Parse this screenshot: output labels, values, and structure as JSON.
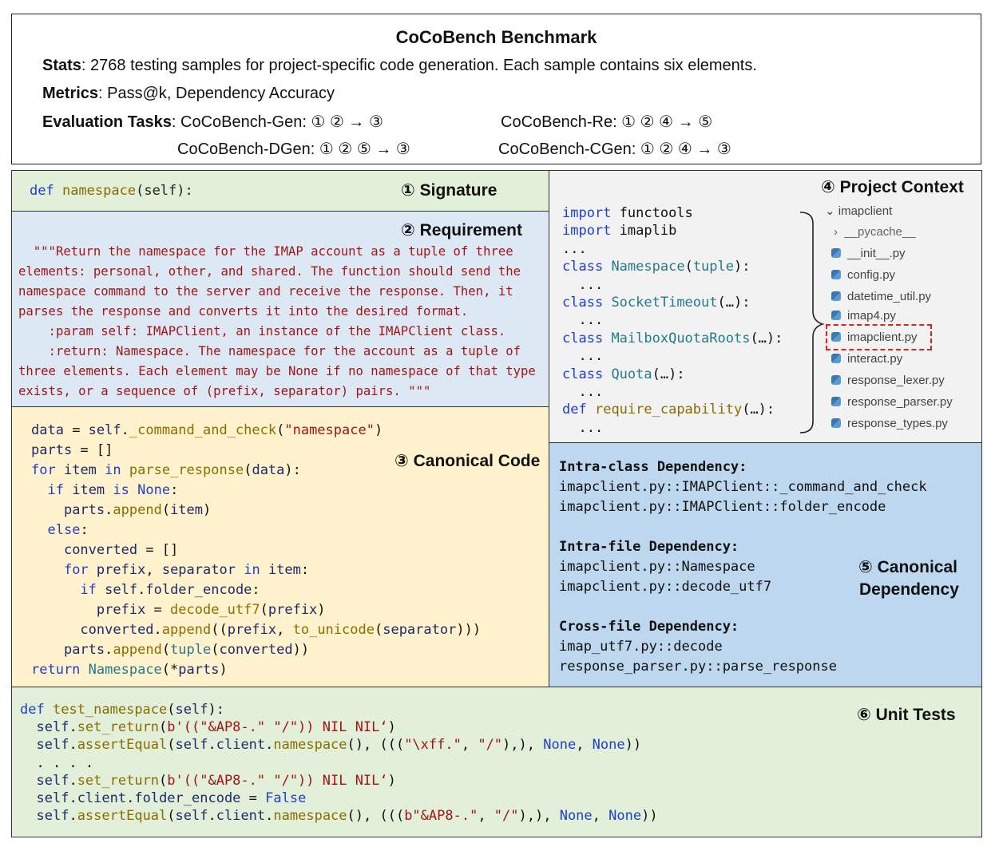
{
  "header": {
    "title": "CoCoBench Benchmark",
    "stats_label": "Stats",
    "stats_text": ": 2768 testing samples for project-specific code generation. Each sample contains six elements.",
    "metrics_label": "Metrics",
    "metrics_text": ": Pass@k, Dependency Accuracy",
    "tasks_label": "Evaluation Tasks",
    "task_gen": ": CoCoBench-Gen: ① ② → ③",
    "task_re": "CoCoBench-Re: ① ② ④ → ⑤",
    "task_dgen": "CoCoBench-DGen: ① ② ⑤ → ③",
    "task_cgen": "CoCoBench-CGen: ① ② ④ → ③"
  },
  "signature": {
    "title": "① Signature",
    "def": "def",
    "name": "namespace",
    "args": "(self):"
  },
  "requirement": {
    "title": "② Requirement",
    "lines": [
      "  \"\"\"Return the namespace for the IMAP account as a tuple of three",
      "elements: personal, other, and shared. The function should send the",
      "namespace command to the server and receive the response. Then, it",
      "parses the response and converts it into the desired format.",
      "    :param self: IMAPClient, an instance of the IMAPClient class.",
      "    :return: Namespace. The namespace for the account as a tuple of",
      "three elements. Each element may be None if no namespace of that type",
      "exists, or a sequence of (prefix, separator) pairs. \"\"\""
    ]
  },
  "canonical_code": {
    "title": "③ Canonical Code"
  },
  "project_context": {
    "title": "④ Project Context",
    "root": "imapclient",
    "files": [
      {
        "name": "__pycache__",
        "type": "folder"
      },
      {
        "name": "__init__.py",
        "type": "py"
      },
      {
        "name": "config.py",
        "type": "py"
      },
      {
        "name": "datetime_util.py",
        "type": "py"
      },
      {
        "name": "imap4.py",
        "type": "py"
      },
      {
        "name": "imapclient.py",
        "type": "py"
      },
      {
        "name": "interact.py",
        "type": "py"
      },
      {
        "name": "response_lexer.py",
        "type": "py"
      },
      {
        "name": "response_parser.py",
        "type": "py"
      },
      {
        "name": "response_types.py",
        "type": "py"
      }
    ]
  },
  "dependency": {
    "title_line1": "⑤ Canonical",
    "title_line2": "Dependency",
    "intra_class_head": "Intra-class Dependency:",
    "intra_class": [
      "imapclient.py::IMAPClient::_command_and_check",
      "imapclient.py::IMAPClient::folder_encode"
    ],
    "intra_file_head": "Intra-file Dependency:",
    "intra_file": [
      "imapclient.py::Namespace",
      "imapclient.py::decode_utf7"
    ],
    "cross_file_head": "Cross-file Dependency:",
    "cross_file": [
      "imap_utf7.py::decode",
      "response_parser.py::parse_response"
    ]
  },
  "tests": {
    "title": "⑥ Unit Tests"
  },
  "colors": {
    "signature_bg": "#e2efd9",
    "requirement_bg": "#dde8f5",
    "code_bg": "#fff2cc",
    "context_bg": "#f2f2f2",
    "dependency_bg": "#bdd7ee",
    "tests_bg": "#e2efd9",
    "highlight": "#e02020"
  }
}
